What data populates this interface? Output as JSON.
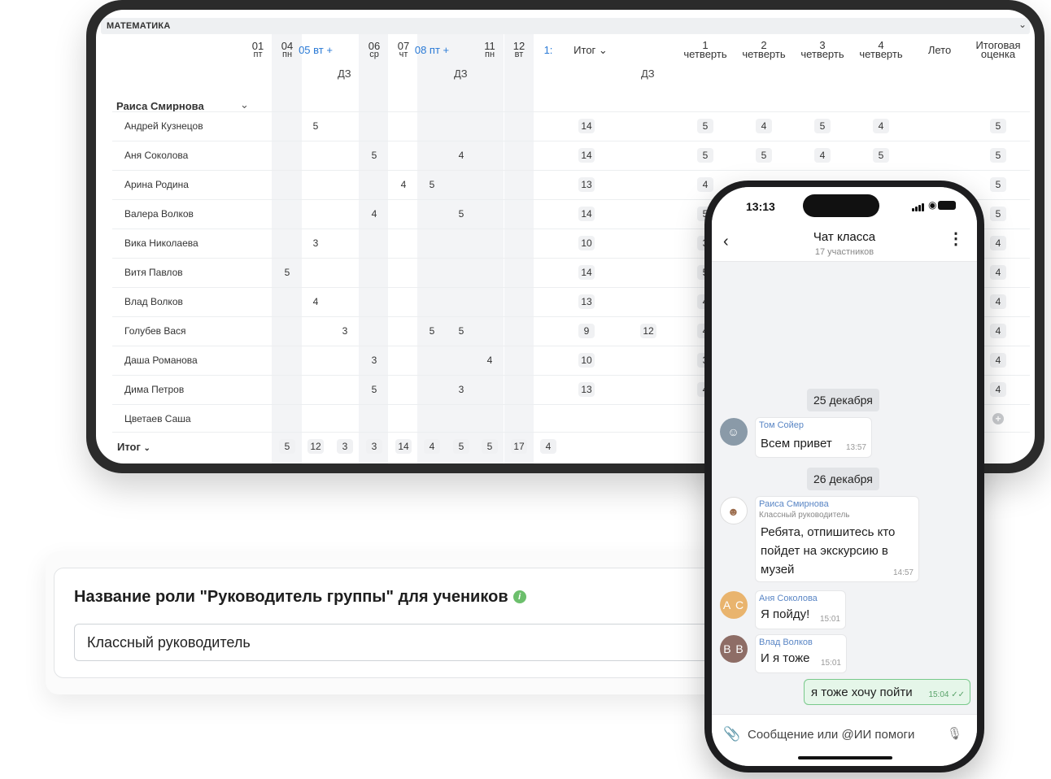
{
  "journal": {
    "subject": "МАТЕМАТИКА",
    "teacher": "Раиса Смирнова",
    "dz_label": "ДЗ",
    "total_label": "Итог",
    "total_head": "Итог",
    "date_columns": [
      {
        "d": "01",
        "w": "пт"
      },
      {
        "d": "04",
        "w": "пн"
      },
      {
        "d": "05 вт",
        "w": "+"
      },
      {
        "d": "06",
        "w": "ср"
      },
      {
        "d": "07",
        "w": "чт"
      },
      {
        "d": "08 пт",
        "w": "+"
      },
      {
        "d": "11",
        "w": "пн"
      },
      {
        "d": "12",
        "w": "вт"
      },
      {
        "d": "1:",
        "w": ""
      }
    ],
    "quarters": [
      {
        "n": "1",
        "l": "четверть"
      },
      {
        "n": "2",
        "l": "четверть"
      },
      {
        "n": "3",
        "l": "четверть"
      },
      {
        "n": "4",
        "l": "четверть"
      }
    ],
    "summer": "Лето",
    "final_1": "Итоговая",
    "final_2": "оценка",
    "students": [
      {
        "name": "Андрей Кузнецов",
        "marks": [
          "",
          "5",
          "",
          "",
          "",
          "",
          "",
          "",
          ""
        ],
        "itog": "14",
        "dz": "",
        "q": [
          "5",
          "4",
          "5",
          "4"
        ],
        "final": "5"
      },
      {
        "name": "Аня Соколова",
        "marks": [
          "",
          "",
          "",
          "5",
          "",
          "",
          "4",
          "",
          ""
        ],
        "itog": "14",
        "dz": "",
        "q": [
          "5",
          "5",
          "4",
          "5"
        ],
        "final": "5"
      },
      {
        "name": "Арина Родина",
        "marks": [
          "",
          "",
          "",
          "",
          "4",
          "5",
          "",
          "",
          ""
        ],
        "itog": "13",
        "dz": "",
        "q": [
          "4",
          "",
          "",
          ""
        ],
        "final": "5"
      },
      {
        "name": "Валера Волков",
        "marks": [
          "",
          "",
          "",
          "4",
          "",
          "",
          "5",
          "",
          ""
        ],
        "itog": "14",
        "dz": "",
        "q": [
          "5",
          "",
          "",
          ""
        ],
        "final": "5"
      },
      {
        "name": "Вика Николаева",
        "marks": [
          "",
          "3",
          "",
          "",
          "",
          "",
          "",
          "",
          ""
        ],
        "itog": "10",
        "dz": "",
        "q": [
          "3",
          "",
          "",
          ""
        ],
        "final": "4"
      },
      {
        "name": "Витя Павлов",
        "marks": [
          "5",
          "",
          "",
          "",
          "",
          "",
          "",
          "",
          ""
        ],
        "itog": "14",
        "dz": "",
        "q": [
          "5",
          "",
          "",
          ""
        ],
        "final": "4"
      },
      {
        "name": "Влад Волков",
        "marks": [
          "",
          "4",
          "",
          "",
          "",
          "",
          "",
          "",
          ""
        ],
        "itog": "13",
        "dz": "",
        "q": [
          "4",
          "",
          "",
          ""
        ],
        "final": "4"
      },
      {
        "name": "Голубев Вася",
        "marks": [
          "",
          "",
          "3",
          "",
          "",
          "5",
          "5",
          "",
          ""
        ],
        "itog": "9",
        "dz": "12",
        "q": [
          "4",
          "",
          "",
          ""
        ],
        "final": "4"
      },
      {
        "name": "Даша Романова",
        "marks": [
          "",
          "",
          "",
          "3",
          "",
          "",
          "",
          "4",
          ""
        ],
        "itog": "10",
        "dz": "",
        "q": [
          "3",
          "",
          "",
          ""
        ],
        "final": "4"
      },
      {
        "name": "Дима Петров",
        "marks": [
          "",
          "",
          "",
          "5",
          "",
          "",
          "3",
          "",
          ""
        ],
        "itog": "13",
        "dz": "",
        "q": [
          "4",
          "",
          "",
          ""
        ],
        "final": "4"
      },
      {
        "name": "Цветаев Саша",
        "marks": [
          "",
          "",
          "",
          "",
          "",
          "",
          "",
          "",
          ""
        ],
        "itog": "",
        "dz": "",
        "q": [
          "",
          "",
          "",
          ""
        ],
        "final": "+"
      }
    ],
    "totals": [
      "5",
      "12",
      "3",
      "3",
      "14",
      "4",
      "5",
      "5",
      "17",
      "4"
    ]
  },
  "role_card": {
    "title": "Название роли \"Руководитель группы\" для учеников",
    "info": "i",
    "value": "Классный руководитель"
  },
  "phone": {
    "time": "13:13",
    "title": "Чат класса",
    "subtitle": "17 участников",
    "input_placeholder": "Сообщение или @ИИ помоги",
    "date1": "25 декабря",
    "date2": "26 декабря",
    "messages": [
      {
        "name": "Том Сойер",
        "text": "Всем привет",
        "time": "13:57"
      },
      {
        "name": "Раиса Смирнова",
        "role": "Классный руководитель",
        "text1": "Ребята, отпишитесь кто",
        "text2": "пойдет на экскурсию в",
        "text3": "музей",
        "time": "14:57"
      },
      {
        "name": "Аня Соколова",
        "initials": "А С",
        "text": "Я пойду!",
        "time": "15:01"
      },
      {
        "name": "Влад Волков",
        "initials": "В В",
        "text": "И я тоже",
        "time": "15:01"
      },
      {
        "text": "я тоже хочу пойти",
        "time": "15:04 ✓✓"
      }
    ],
    "colors": {
      "accent": "#5a86c5",
      "mine_bg": "#e5f6e9",
      "mine_border": "#79c98b",
      "avatar_as": "#e9b46e",
      "avatar_vv": "#8e6d66"
    }
  }
}
